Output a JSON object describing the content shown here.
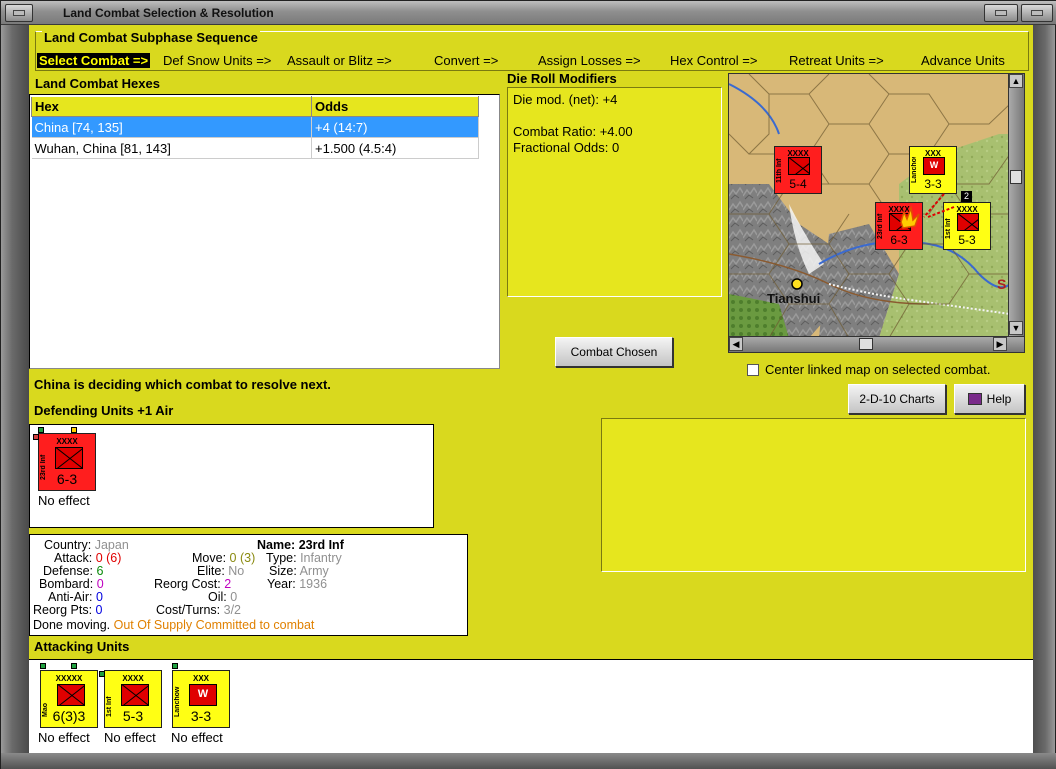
{
  "window": {
    "title": "Land Combat Selection & Resolution"
  },
  "subphase": {
    "title": "Land Combat Subphase Sequence",
    "steps": [
      "Select Combat =>",
      "Def Snow Units =>",
      "Assault or Blitz =>",
      "Convert =>",
      "Assign Losses =>",
      "Hex Control =>",
      "Retreat Units =>",
      "Advance Units"
    ]
  },
  "hexes": {
    "label": "Land Combat Hexes",
    "columns": [
      "Hex",
      "Odds"
    ],
    "rows": [
      [
        "China [74, 135]",
        "+4 (14:7)"
      ],
      [
        "Wuhan, China [81, 143]",
        "+1.500 (4.5:4)"
      ]
    ]
  },
  "drm": {
    "label": "Die Roll Modifiers",
    "lines": [
      "Die mod. (net): +4",
      "",
      "Combat Ratio: +4.00",
      "Fractional Odds: 0"
    ]
  },
  "map": {
    "city": "Tianshui",
    "edge_letter": "S",
    "counters": [
      {
        "size": "XXXX",
        "name": "11th Inf",
        "strength": "5-4",
        "color": "red"
      },
      {
        "size": "XXX",
        "name": "Lanchow Wld",
        "strength": "3-3",
        "color": "yellow",
        "w": "W"
      },
      {
        "size": "XXXX",
        "name": "23rd Inf",
        "strength": "6-3",
        "color": "red"
      },
      {
        "size": "XXXX",
        "name": "1st Inf",
        "strength": "5-3",
        "color": "yellow",
        "badge": "2"
      }
    ]
  },
  "combat_chosen_button": "Combat Chosen",
  "center_map_label": "Center linked map on selected combat.",
  "charts_button": "2-D-10 Charts",
  "help_button": "Help",
  "status": "China is deciding which combat to resolve next.",
  "defending": {
    "label": "Defending Units +1 Air",
    "units": [
      {
        "size": "XXXX",
        "name": "23rd Inf",
        "strength": "6-3",
        "result": "No effect"
      }
    ]
  },
  "info": {
    "country_label": "Country:",
    "country": "Japan",
    "attack_label": "Attack:",
    "attack": "0",
    "attack_paren": "(6)",
    "defense_label": "Defense:",
    "defense": "6",
    "bombard_label": "Bombard:",
    "bombard": "0",
    "antiair_label": "Anti-Air:",
    "antiair": "0",
    "reorgpts_label": "Reorg Pts:",
    "reorgpts": "0",
    "move_label": "Move:",
    "move": "0",
    "move_paren": "(3)",
    "elite_label": "Elite:",
    "elite": "No",
    "reorgcost_label": "Reorg Cost:",
    "reorgcost": "2",
    "oil_label": "Oil:",
    "oil": "0",
    "costturns_label": "Cost/Turns:",
    "costturns": "3/2",
    "name_label": "Name:",
    "name": "23rd Inf",
    "type_label": "Type:",
    "type": "Infantry",
    "size_label": "Size:",
    "size": "Army",
    "year_label": "Year:",
    "year": "1936",
    "done_moving": "Done moving.",
    "supply": "Out Of Supply",
    "committed": "Committed to combat"
  },
  "attacking": {
    "label": "Attacking Units",
    "units": [
      {
        "size": "XXXXX",
        "name": "Mao",
        "strength": "6(3)3",
        "result": "No effect"
      },
      {
        "size": "XXXX",
        "name": "1st Inf",
        "strength": "5-3",
        "result": "No effect"
      },
      {
        "size": "XXX",
        "name": "Lanchow Wld",
        "strength": "3-3",
        "w": "W",
        "result": "No effect"
      }
    ]
  },
  "colors": {
    "panel_yellow": "#d9d91e",
    "selection_blue": "#3399ff",
    "counter_red": "#ff1e1e",
    "counter_yellow": "#ffff14"
  }
}
